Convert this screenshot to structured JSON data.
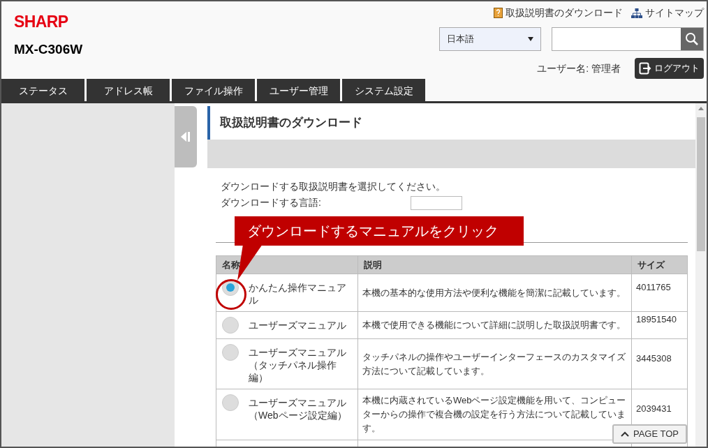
{
  "header": {
    "logo": "SHARP",
    "model": "MX-C306W",
    "links": [
      {
        "kind": "manual",
        "text": "取扱説明書のダウンロード"
      },
      {
        "kind": "sitemap",
        "text": "サイトマップ"
      }
    ],
    "language": "日本語",
    "user_label": "ユーザー名: 管理者",
    "logout": "ログアウト"
  },
  "tabs": [
    {
      "label": "ステータス",
      "selected": false
    },
    {
      "label": "アドレス帳",
      "selected": false
    },
    {
      "label": "ファイル操作",
      "selected": false
    },
    {
      "label": "ユーザー管理",
      "selected": false
    },
    {
      "label": "システム設定",
      "selected": false
    }
  ],
  "page": {
    "title": "取扱説明書のダウンロード",
    "instruction": "ダウンロードする取扱説明書を選択してください。",
    "language_label": "ダウンロードする言語:",
    "callout": "ダウンロードするマニュアルをクリック"
  },
  "table": {
    "columns": [
      "名称",
      "説明",
      "サイズ"
    ],
    "rows": [
      {
        "name": "かんたん操作マニュアル",
        "description": "本機の基本的な使用方法や便利な機能を簡潔に記載しています。",
        "size": "4011765",
        "selected": true
      },
      {
        "name": "ユーザーズマニュアル",
        "description": "本機で使用できる機能について詳細に説明した取扱説明書です。",
        "size": "18951540",
        "selected": false
      },
      {
        "name": "ユーザーズマニュアル（タッチパネル操作編）",
        "description": "タッチパネルの操作やユーザーインターフェースのカスタマイズ方法について記載しています。",
        "size": "3445308",
        "selected": false
      },
      {
        "name": "ユーザーズマニュアル（Webページ設定編）",
        "description": "本機に内蔵されているWebページ設定機能を用いて、コンピューターからの操作で複合機の設定を行う方法について記載しています。",
        "size": "2039431",
        "selected": false
      }
    ]
  },
  "page_top": "PAGE TOP"
}
